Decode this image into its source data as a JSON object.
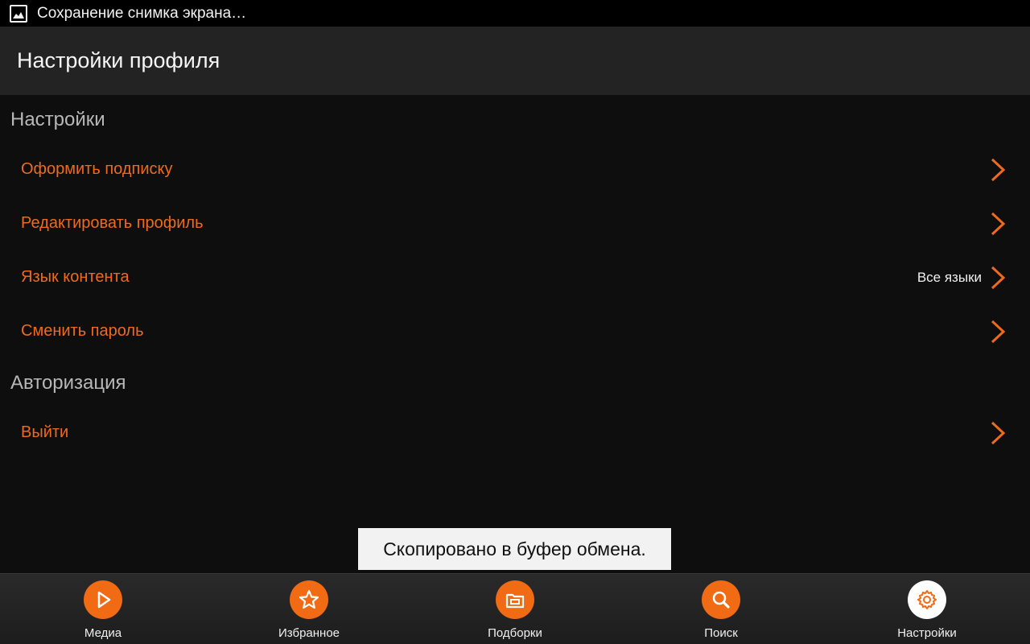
{
  "status_bar": {
    "notification": "Сохранение снимка экрана…",
    "icon": "image-icon"
  },
  "header": {
    "title": "Настройки профиля"
  },
  "sections": {
    "settings": {
      "title": "Настройки",
      "items": [
        {
          "label": "Оформить подписку",
          "value": ""
        },
        {
          "label": "Редактировать профиль",
          "value": ""
        },
        {
          "label": "Язык контента",
          "value": "Все языки"
        },
        {
          "label": "Сменить пароль",
          "value": ""
        }
      ]
    },
    "auth": {
      "title": "Авторизация",
      "items": [
        {
          "label": "Выйти",
          "value": ""
        }
      ]
    }
  },
  "toast": {
    "text": "Скопировано в буфер обмена."
  },
  "bottom_nav": {
    "active": "Настройки",
    "items": [
      {
        "label": "Медиа",
        "icon": "play-icon"
      },
      {
        "label": "Избранное",
        "icon": "star-icon"
      },
      {
        "label": "Подборки",
        "icon": "folder-icon"
      },
      {
        "label": "Поиск",
        "icon": "search-icon"
      },
      {
        "label": "Настройки",
        "icon": "gear-icon"
      }
    ]
  },
  "colors": {
    "accent": "#f06b14",
    "label_orange": "#ee6a1c",
    "background": "#0e0e0e",
    "action_bar": "#232323"
  }
}
